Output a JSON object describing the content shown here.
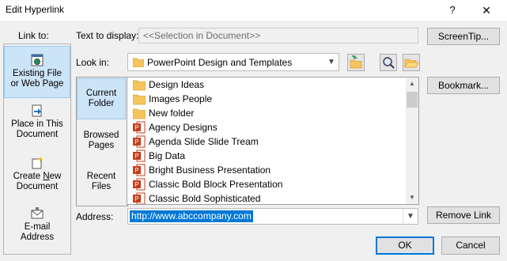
{
  "window": {
    "title": "Edit Hyperlink",
    "help_glyph": "?",
    "close_glyph": "✕"
  },
  "link_to": {
    "label": "Link to:",
    "items": [
      {
        "line1": "Existing File",
        "line2": "or Web Page",
        "icon": "web-page-icon",
        "selected": true
      },
      {
        "line1": "Place in This",
        "line2": "Document",
        "icon": "place-in-document-icon",
        "selected": false
      },
      {
        "line1": "Create New",
        "line2": "Document",
        "icon": "new-document-icon",
        "selected": false
      },
      {
        "line1": "E-mail",
        "line2": "Address",
        "icon": "email-icon",
        "selected": false
      }
    ]
  },
  "text_to_display": {
    "label": "Text to display:",
    "value": "<<Selection in Document>>"
  },
  "screentip_button": "ScreenTip...",
  "look_in": {
    "label": "Look in:",
    "value": "PowerPoint Design and Templates"
  },
  "bookmark_button": "Bookmark...",
  "side_tabs": [
    {
      "line1": "Current",
      "line2": "Folder",
      "selected": true
    },
    {
      "line1": "Browsed",
      "line2": "Pages",
      "selected": false
    },
    {
      "line1": "Recent",
      "line2": "Files",
      "selected": false
    }
  ],
  "files": [
    {
      "name": "Design Ideas",
      "type": "folder"
    },
    {
      "name": "Images People",
      "type": "folder"
    },
    {
      "name": "New folder",
      "type": "folder"
    },
    {
      "name": "Agency Designs",
      "type": "pptx"
    },
    {
      "name": "Agenda Slide Slide Tream",
      "type": "pptx"
    },
    {
      "name": "Big Data",
      "type": "pptx"
    },
    {
      "name": "Bright Business Presentation",
      "type": "pptx"
    },
    {
      "name": "Classic Bold Block Presentation",
      "type": "pptx"
    },
    {
      "name": "Classic Bold Sophisticated",
      "type": "pptx"
    }
  ],
  "address": {
    "label": "Address:",
    "value": "http://www.abccompany.com"
  },
  "remove_link_button": "Remove Link",
  "ok_button": "OK",
  "cancel_button": "Cancel",
  "colors": {
    "accent": "#0078d7",
    "selection_bg": "#cce4f7",
    "folder": "#f5c45b",
    "pptx": "#c43e1c"
  }
}
